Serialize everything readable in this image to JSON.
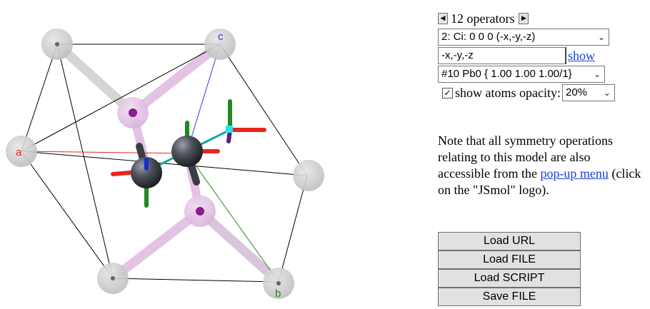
{
  "operators": {
    "prev_icon": "triangle-left",
    "next_icon": "triangle-right",
    "count_label": "12 operators",
    "selected_operator": "2: Ci: 0 0 0 (-x,-y,-z)",
    "operation_text": "-x,-y,-z",
    "show_link": "show",
    "atom_selection": "#10 Pb0 { 1.00 1.00 1.00/1}",
    "show_atoms_checked": true,
    "show_atoms_label": "show atoms opacity:",
    "opacity_value": "20%"
  },
  "note": {
    "text_before": "Note that all symmetry operations relating to this model are also accessible from the ",
    "link_text": "pop-up menu",
    "text_after": " (click on the \"JSmol\" logo)."
  },
  "buttons": {
    "load_url": "Load URL",
    "load_file": "Load FILE",
    "load_script": "Load SCRIPT",
    "save_file": "Save FILE"
  },
  "viewer": {
    "axis_a": "a",
    "axis_b": "b",
    "axis_c": "c",
    "colors": {
      "a_axis": "#e8261e",
      "b_axis": "#1f8a1f",
      "c_axis": "#2f3fd8",
      "bond": "#1aa3a3",
      "atom": "#4a4e56"
    }
  }
}
